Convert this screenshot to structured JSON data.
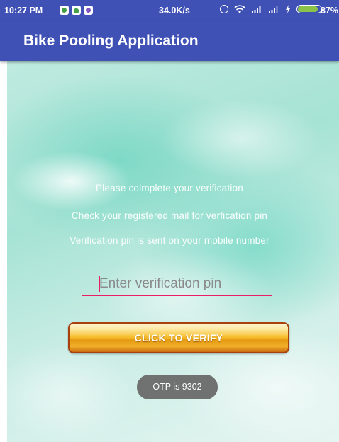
{
  "status_bar": {
    "time": "10:27 PM",
    "speed": "34.0K/s",
    "battery_percent": "87%",
    "battery_level": 0.87,
    "notification_icons": [
      "whatsapp-icon",
      "android-icon",
      "viber-icon"
    ],
    "system_icons": [
      "sync-icon",
      "wifi-icon",
      "signal-icon",
      "signal-icon",
      "charge-icon",
      "battery-icon"
    ]
  },
  "app_bar": {
    "title": "Bike Pooling Application",
    "color": "#3f51b5"
  },
  "main": {
    "line1": "Please colmplete your verification",
    "line2": "Check your registered mail for verfication pin",
    "line3": "Verification pin is sent on your mobile number",
    "pin_input": {
      "value": "",
      "placeholder": "Enter verification pin",
      "underline_color": "#e91e63"
    },
    "verify_button": {
      "label": "CLICK TO VERIFY"
    }
  },
  "toast": {
    "text": "OTP is 9302"
  }
}
